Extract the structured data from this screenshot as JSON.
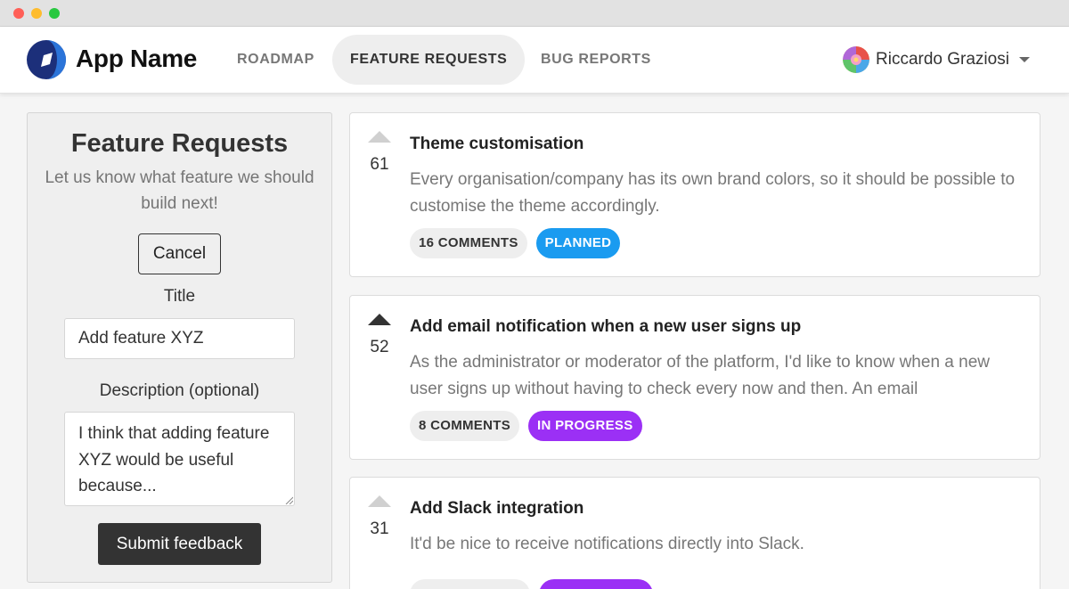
{
  "window": {
    "controls": [
      "close",
      "minimize",
      "maximize"
    ]
  },
  "navbar": {
    "app_name": "App Name",
    "logo_icon": "app-logo-icon",
    "links": [
      {
        "label": "ROADMAP",
        "active": false
      },
      {
        "label": "FEATURE REQUESTS",
        "active": true
      },
      {
        "label": "BUG REPORTS",
        "active": false
      }
    ],
    "user": {
      "name": "Riccardo Graziosi",
      "avatar_icon": "avatar-icon",
      "menu_icon": "caret-down-icon"
    }
  },
  "sidebar": {
    "title": "Feature Requests",
    "subtitle": "Let us know what feature we should build next!",
    "cancel_label": "Cancel",
    "title_label": "Title",
    "title_value": "Add feature XYZ",
    "description_label": "Description (optional)",
    "description_value": "I think that adding feature XYZ would be useful because...",
    "submit_label": "Submit feedback"
  },
  "posts": [
    {
      "title": "Theme customisation",
      "description": "Every organisation/company has its own brand colors, so it should be possible to customise the theme accordingly.",
      "votes": "61",
      "voted": false,
      "comments": "16 COMMENTS",
      "status": "PLANNED",
      "status_color": "#1a9bf0"
    },
    {
      "title": "Add email notification when a new user signs up",
      "description": "As the administrator or moderator of the platform, I'd like to know when a new user signs up without having to check every now and then. An email",
      "votes": "52",
      "voted": true,
      "comments": "8 COMMENTS",
      "status": "IN PROGRESS",
      "status_color": "#9b30f5"
    },
    {
      "title": "Add Slack integration",
      "description": "It'd be nice to receive notifications directly into Slack.",
      "votes": "31",
      "voted": false,
      "status_color": "#9b30f5"
    }
  ]
}
